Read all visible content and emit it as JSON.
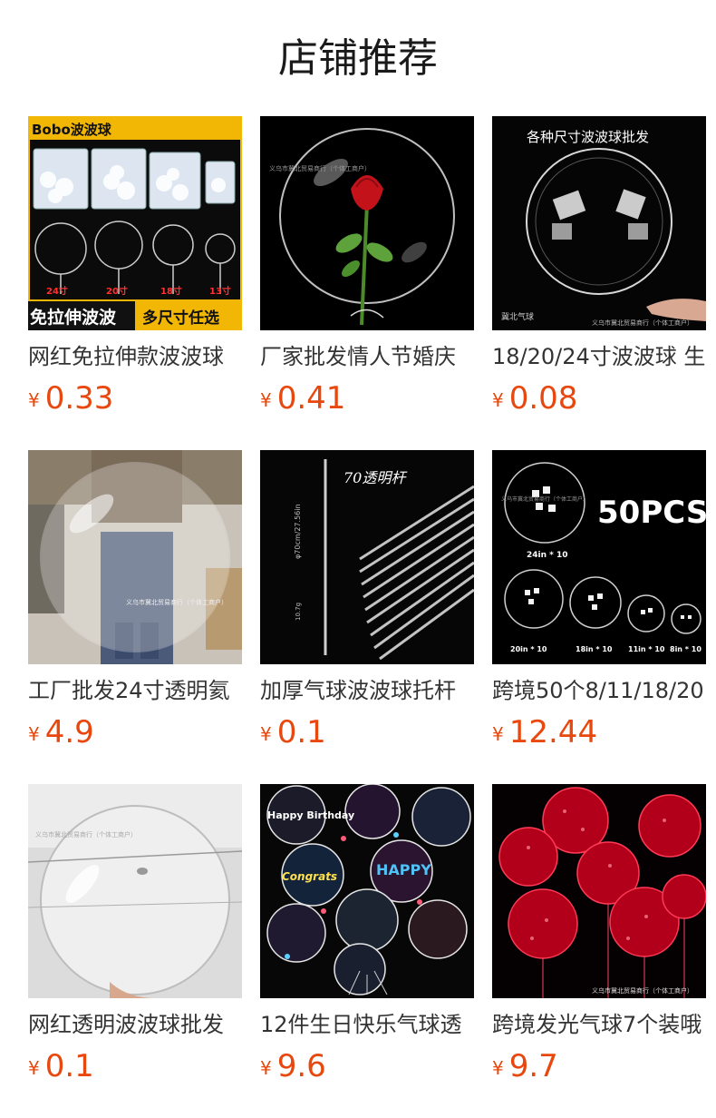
{
  "page": {
    "title": "店铺推荐",
    "currency_symbol": "¥",
    "price_color": "#e8470d"
  },
  "products": [
    {
      "name": "网红免拉伸款波波球",
      "price": "0.33",
      "image_texts": [
        "Bobo波波球",
        "24寸",
        "20寸",
        "18寸",
        "13寸",
        "免拉伸波波",
        "多尺寸任选",
        "BOBO"
      ]
    },
    {
      "name": "厂家批发情人节婚庆",
      "price": "0.41",
      "image_texts": [
        "义乌市冀北贸易商行（个体工商户）"
      ]
    },
    {
      "name": "18/20/24寸波波球 生",
      "price": "0.08",
      "image_texts": [
        "各种尺寸波波球批发",
        "冀北气球",
        "义乌市冀北贸易商行（个体工商户）"
      ]
    },
    {
      "name": "工厂批发24寸透明氦",
      "price": "4.9",
      "image_texts": [
        "义乌市冀北贸易商行（个体工商户）"
      ]
    },
    {
      "name": "加厚气球波波球托杆",
      "price": "0.1",
      "image_texts": [
        "70透明杆",
        "φ70cm/27.56in",
        "10.7g"
      ]
    },
    {
      "name": "跨境50个8/11/18/20",
      "price": "12.44",
      "image_texts": [
        "50PCS",
        "24in * 10",
        "20in * 10",
        "18in * 10",
        "11in * 10",
        "8in * 10",
        "义乌市冀北贸易商行（个体工商户）"
      ]
    },
    {
      "name": "网红透明波波球批发",
      "price": "0.1",
      "image_texts": [
        "义乌市冀北贸易商行（个体工商户）"
      ]
    },
    {
      "name": "12件生日快乐气球透",
      "price": "9.6",
      "image_texts": [
        "Happy Birthday",
        "Congrats",
        "HAPPY"
      ]
    },
    {
      "name": "跨境发光气球7个装哦",
      "price": "9.7",
      "image_texts": [
        "义乌市冀北贸易商行（个体工商户）"
      ]
    }
  ]
}
